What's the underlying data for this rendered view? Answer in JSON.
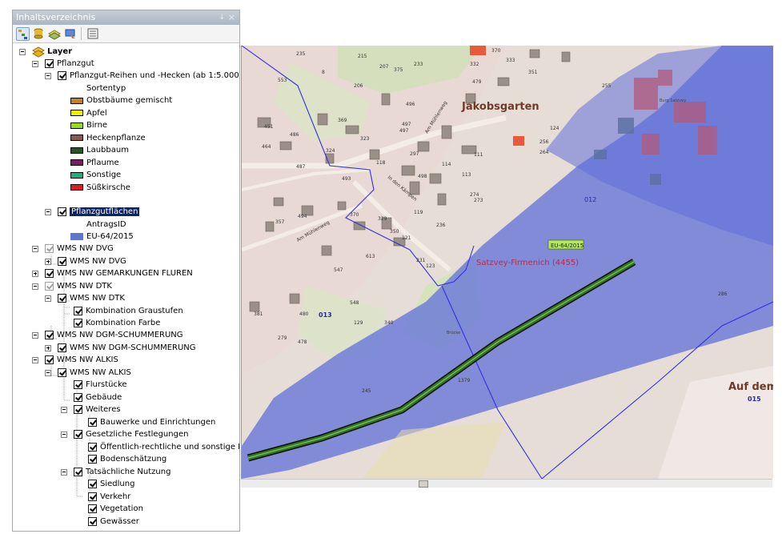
{
  "toc": {
    "title": "Inhaltsverzeichnis",
    "pin_glyph": "↓",
    "close_glyph": "×"
  },
  "tree": {
    "layer": "Layer",
    "pflanzgut": "Pflanzgut",
    "reihen": "Pflanzgut-Reihen und -Hecken (ab 1:5.000)",
    "sortentyp": "Sortentyp",
    "legend": [
      {
        "label": "Obstbäume gemischt",
        "color": "#c8821e"
      },
      {
        "label": "Apfel",
        "color": "#f0f000"
      },
      {
        "label": "Birne",
        "color": "#96dc1e"
      },
      {
        "label": "Heckenpflanze",
        "color": "#8c5a4a"
      },
      {
        "label": "Laubbaum",
        "color": "#1e5a1e"
      },
      {
        "label": "Pflaume",
        "color": "#7a1e5a"
      },
      {
        "label": "Sonstige",
        "color": "#2ea87a"
      },
      {
        "label": "Süßkirsche",
        "color": "#dc1e1e"
      }
    ],
    "flaechen": "Pflanzgutflächen",
    "antragsid": "AntragsID",
    "eu": "EU-64/2015",
    "eu_color": "#5a78d2",
    "dvg": "WMS NW DVG",
    "dvg_sub": "WMS NW DVG",
    "fluren": "WMS NW GEMARKUNGEN FLUREN",
    "dtk": "WMS NW DTK",
    "dtk_sub": "WMS NW DTK",
    "graustufen": "Kombination Graustufen",
    "farbe": "Kombination Farbe",
    "dgm": "WMS NW DGM-SCHUMMERUNG",
    "dgm_sub": "WMS NW DGM-SCHUMMERUNG",
    "alkis": "WMS NW ALKIS",
    "alkis_sub": "WMS NW ALKIS",
    "flurstuecke": "Flurstücke",
    "gebaeude": "Gebäude",
    "weiteres": "Weiteres",
    "bauwerke": "Bauwerke und Einrichtungen",
    "festlegungen": "Gesetzliche Festlegungen",
    "oeffentlich": "Öffentlich-rechtliche und sonstige Festlegungen",
    "boden": "Bodenschätzung",
    "nutzung": "Tatsächliche Nutzung",
    "siedlung": "Siedlung",
    "verkehr": "Verkehr",
    "vegetation": "Vegetation",
    "gewaesser": "Gewässer"
  },
  "map": {
    "place1": "Jakobsgarten",
    "place2": "Auf dem",
    "district": "Satzvey-Firmenich (4455)",
    "badge": "EU-64/2015",
    "flur_012": "012",
    "flur_013": "013",
    "flur_015": "015",
    "street1": "Am Mühlenweg",
    "street2": "In den Kämpen",
    "street3": "Am Mühlenweg",
    "burg": "Burg Satzvey",
    "bruecke": "Brücke",
    "parcels": [
      "235",
      "215",
      "207",
      "375",
      "370",
      "553",
      "8",
      "233",
      "332",
      "479",
      "206",
      "333",
      "351",
      "369",
      "255",
      "451",
      "496",
      "497",
      "124",
      "497",
      "256",
      "464",
      "486",
      "324",
      "323",
      "118",
      "264",
      "111",
      "297",
      "114",
      "498",
      "487",
      "493",
      "113",
      "274",
      "273",
      "357",
      "494",
      "370",
      "119",
      "329",
      "350",
      "236",
      "121",
      "231",
      "123",
      "613",
      "547",
      "548",
      "480",
      "381",
      "129",
      "340",
      "279",
      "478",
      "286",
      "245",
      "1379"
    ]
  },
  "colors": {
    "water": "#6e7cd8",
    "selection": "#0a246a",
    "boundary": "#3030e0",
    "place_label": "#6e3a2a"
  }
}
